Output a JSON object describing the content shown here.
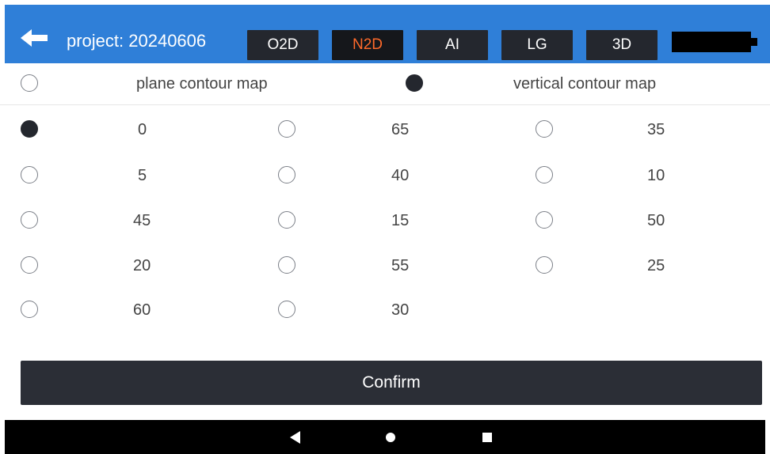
{
  "header": {
    "project_title": "project: 20240606",
    "modes": [
      {
        "label": "O2D",
        "active": false
      },
      {
        "label": "N2D",
        "active": true
      },
      {
        "label": "AI",
        "active": false
      },
      {
        "label": "LG",
        "active": false
      },
      {
        "label": "3D",
        "active": false
      }
    ]
  },
  "map_type": {
    "options": [
      {
        "label": "plane contour map",
        "selected": false
      },
      {
        "label": "vertical contour map",
        "selected": true
      }
    ]
  },
  "angles": {
    "columns": [
      [
        "0",
        "5",
        "45",
        "20",
        "60"
      ],
      [
        "65",
        "40",
        "15",
        "55",
        "30"
      ],
      [
        "35",
        "10",
        "50",
        "25"
      ]
    ],
    "selected": "0"
  },
  "confirm_label": "Confirm",
  "colors": {
    "header_bg": "#2f7fd8",
    "button_dark": "#24272e",
    "active_text": "#ff6a2a"
  }
}
